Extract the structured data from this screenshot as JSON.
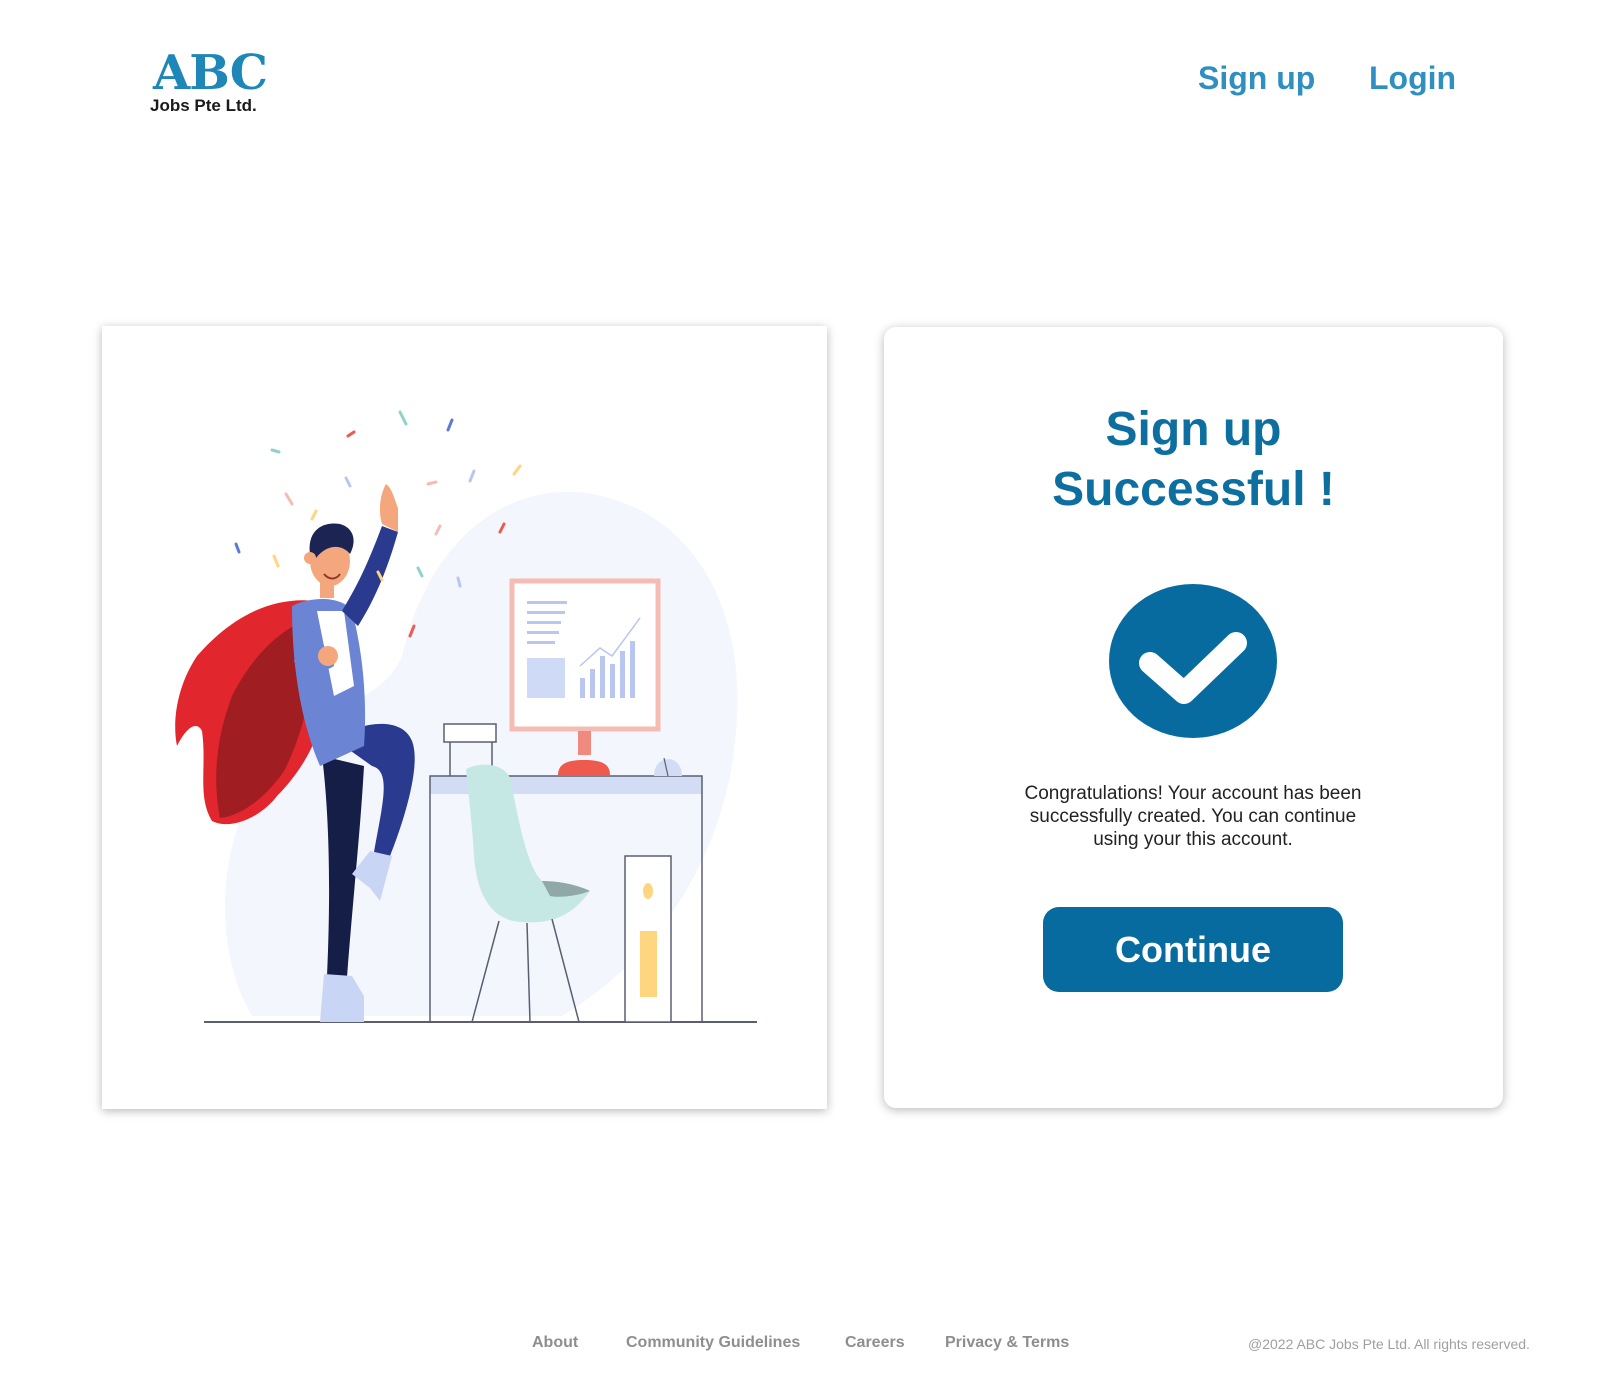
{
  "header": {
    "logo_mark": "ABC",
    "logo_sub": "Jobs Pte Ltd.",
    "nav": {
      "signup": "Sign up",
      "login": "Login"
    }
  },
  "illustration": {
    "description_icon": "celebrating-superhero-illustration"
  },
  "success": {
    "title_line1": "Sign up",
    "title_line2": "Successful !",
    "icon": "check-circle-icon",
    "message": "Congratulations! Your account has been successfully created. You can continue using your this account.",
    "continue_label": "Continue"
  },
  "footer": {
    "links": [
      "About",
      "Community Guidelines",
      "Careers",
      "Privacy & Terms"
    ],
    "copyright": "@2022 ABC Jobs Pte Ltd. All rights reserved."
  },
  "colors": {
    "brand": "#0c6f9f",
    "nav": "#2f8fc0",
    "button": "#076b9f",
    "footer_text": "#8e8e8e"
  }
}
